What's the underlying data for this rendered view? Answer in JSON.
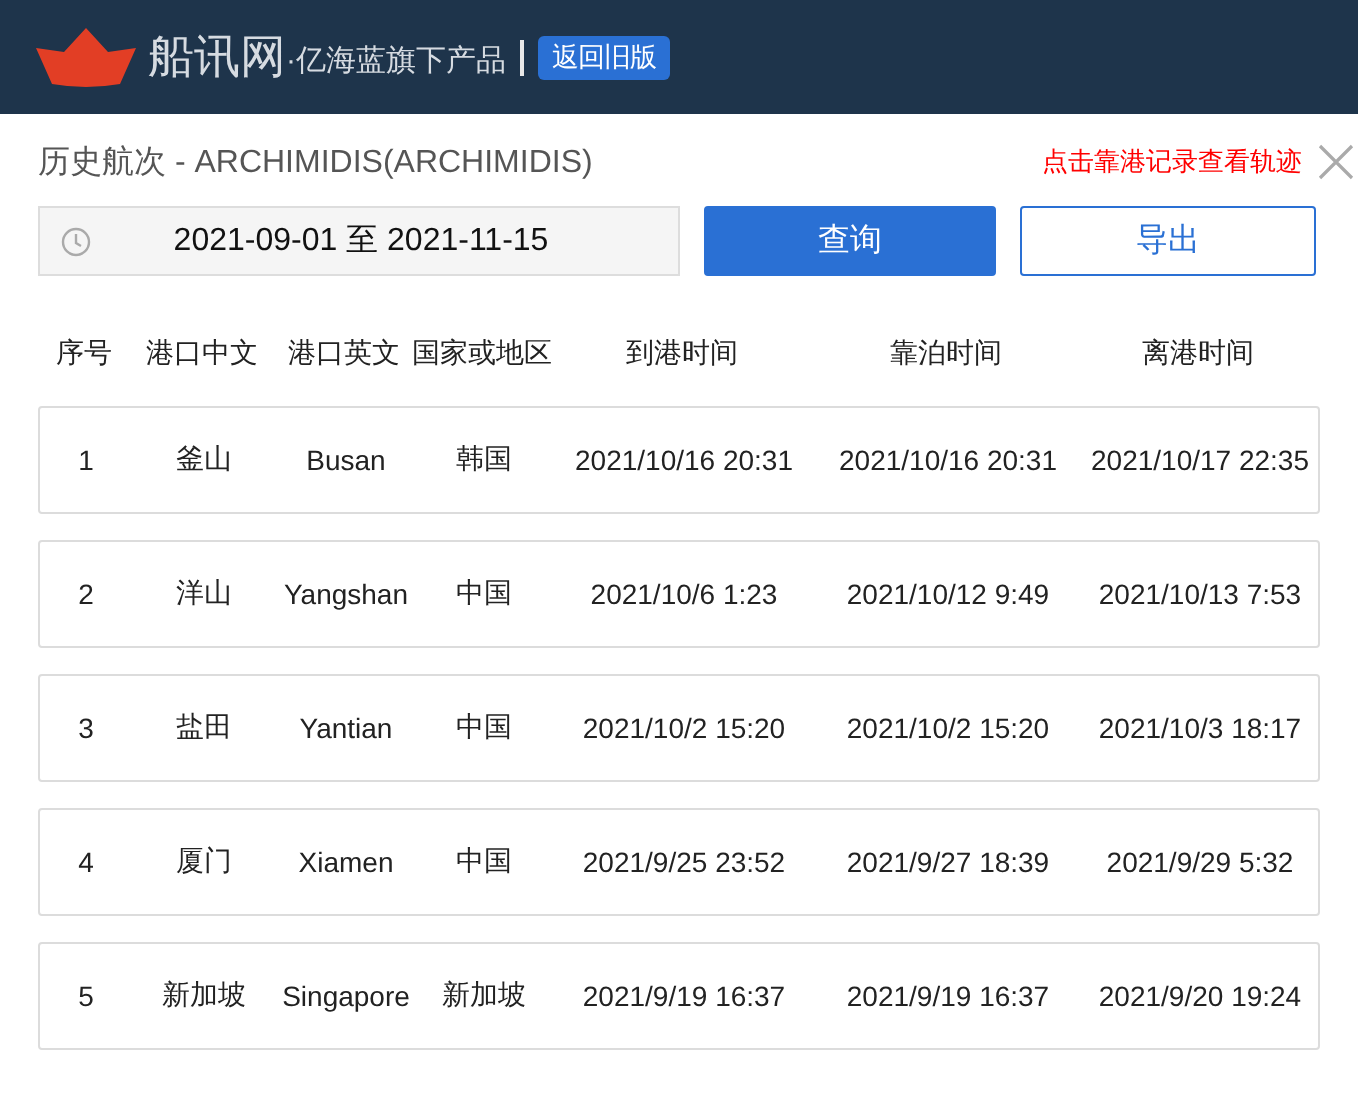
{
  "header": {
    "site_name": "船讯网",
    "tagline": "·亿海蓝旗下产品",
    "old_version_button": "返回旧版"
  },
  "panel": {
    "title": "历史航次 - ARCHIMIDIS(ARCHIMIDIS)",
    "hint": "点击靠港记录查看轨迹",
    "date_range": "2021-09-01 至 2021-11-15",
    "buttons": [
      {
        "label": "查询",
        "kind": "primary"
      },
      {
        "label": "导出",
        "kind": "outline"
      }
    ],
    "columns": [
      "序号",
      "港口中文",
      "港口英文",
      "国家或地区",
      "到港时间",
      "靠泊时间",
      "离港时间"
    ],
    "rows": [
      {
        "index": "1",
        "port_cn": "釜山",
        "port_en": "Busan",
        "country": "韩国",
        "arrival": "2021/10/16 20:31",
        "berthing": "2021/10/16 20:31",
        "departure": "2021/10/17 22:35"
      },
      {
        "index": "2",
        "port_cn": "洋山",
        "port_en": "Yangshan",
        "country": "中国",
        "arrival": "2021/10/6 1:23",
        "berthing": "2021/10/12 9:49",
        "departure": "2021/10/13 7:53"
      },
      {
        "index": "3",
        "port_cn": "盐田",
        "port_en": "Yantian",
        "country": "中国",
        "arrival": "2021/10/2 15:20",
        "berthing": "2021/10/2 15:20",
        "departure": "2021/10/3 18:17"
      },
      {
        "index": "4",
        "port_cn": "厦门",
        "port_en": "Xiamen",
        "country": "中国",
        "arrival": "2021/9/25 23:52",
        "berthing": "2021/9/27 18:39",
        "departure": "2021/9/29 5:32"
      },
      {
        "index": "5",
        "port_cn": "新加坡",
        "port_en": "Singapore",
        "country": "新加坡",
        "arrival": "2021/9/19 16:37",
        "berthing": "2021/9/19 16:37",
        "departure": "2021/9/20 19:24"
      }
    ]
  }
}
